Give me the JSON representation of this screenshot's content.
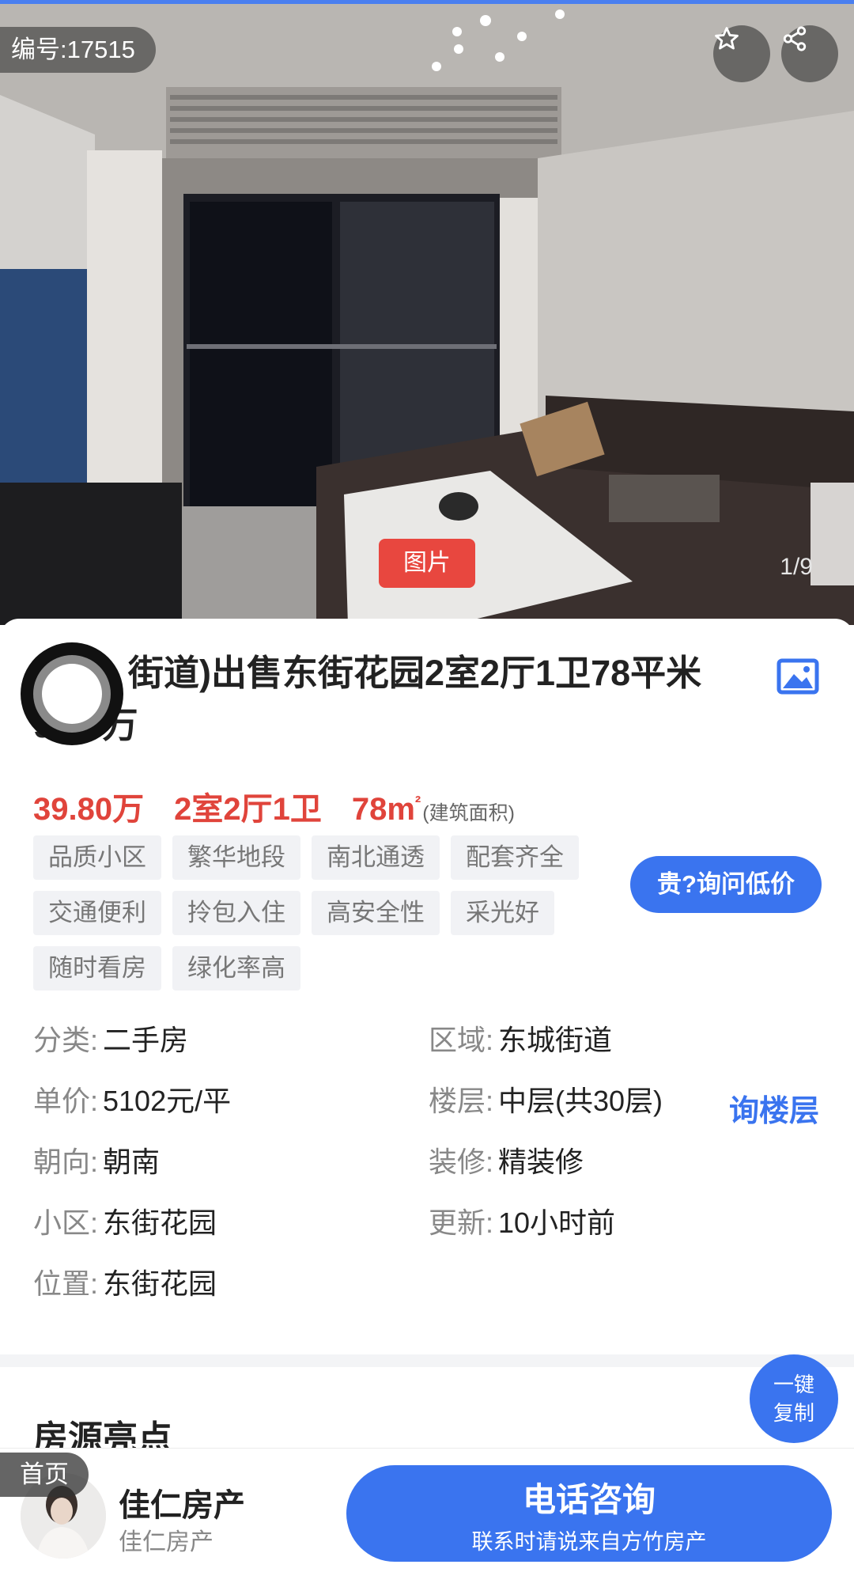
{
  "photo": {
    "id_label": "编号:17515",
    "image_tag": "图片",
    "counter": "1/9",
    "favorite_icon": "star-icon",
    "share_icon": "share-icon"
  },
  "listing": {
    "title": "街道)出售东街花园2室2厅1卫78平米 9.80万",
    "price": "39.80万",
    "layout": "2室2厅1卫",
    "area": "78m",
    "area_sup": "²",
    "area_note": "(建筑面积)",
    "tags": [
      "品质小区",
      "繁华地段",
      "南北通透",
      "配套齐全",
      "交通便利",
      "拎包入住",
      "高安全性",
      "采光好",
      "随时看房",
      "绿化率高"
    ],
    "ask_price_label": "贵?询问低价"
  },
  "info": {
    "category_key": "分类:",
    "category": "二手房",
    "region_key": "区域:",
    "region": "东城街道",
    "unit_price_key": "单价:",
    "unit_price": "5102元/平",
    "floor_key": "楼层:",
    "floor": "中层(共30层)",
    "floor_link": "询楼层",
    "orientation_key": "朝向:",
    "orientation": "朝南",
    "decoration_key": "装修:",
    "decoration": "精装修",
    "community_key": "小区:",
    "community": "东街花园",
    "updated_key": "更新:",
    "updated": "10小时前",
    "location_key": "位置:",
    "location": "东街花园"
  },
  "highlights": {
    "title": "房源亮点"
  },
  "copy_button": {
    "line1": "一键",
    "line2": "复制"
  },
  "bottom": {
    "home_tab": "首页",
    "agent_name": "佳仁房产",
    "agent_company": "佳仁房产",
    "call_main": "电话咨询",
    "call_sub": "联系时请说来自方竹房产"
  },
  "colors": {
    "accent": "#3a74ef",
    "price": "#e0443b",
    "image_tag": "#e8473f"
  }
}
